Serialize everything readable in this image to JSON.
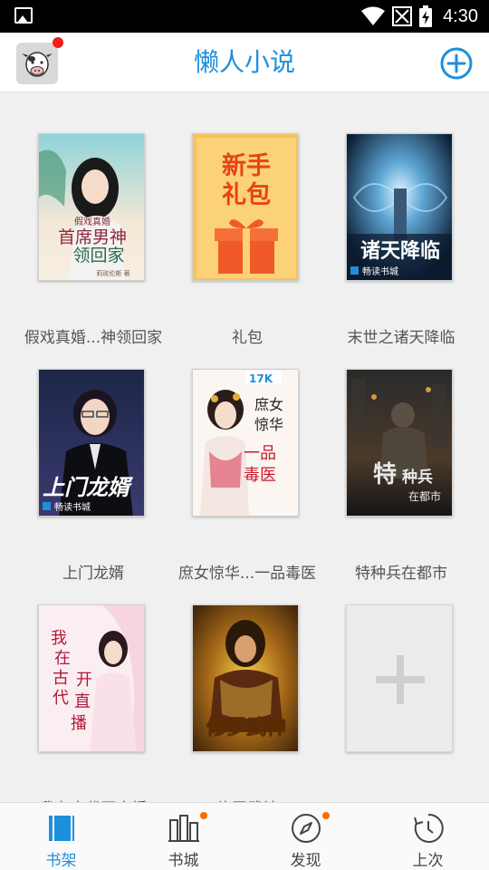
{
  "status_bar": {
    "time": "4:30"
  },
  "header": {
    "title": "懒人小说"
  },
  "books": [
    {
      "title": "假戏真婚...神领回家",
      "cover_text": "假戏真婚 首席男神 领回家"
    },
    {
      "title": "礼包",
      "cover_text": "新手 礼包"
    },
    {
      "title": "末世之诸天降临",
      "cover_text": "诸天降临",
      "cover_badge": "畅读书城"
    },
    {
      "title": "上门龙婿",
      "cover_text": "上门龙婿",
      "cover_badge": "畅读书城"
    },
    {
      "title": "庶女惊华...一品毒医",
      "cover_text": "庶女惊华 一品毒医",
      "cover_badge": "17K"
    },
    {
      "title": "特种兵在都市",
      "cover_text": "特种兵 在都市"
    },
    {
      "title": "我在古代开直播",
      "cover_text": "我在古代开直播"
    },
    {
      "title": "修罗武神",
      "cover_text": "修罗武神"
    }
  ],
  "bottom_nav": [
    {
      "label": "书架",
      "icon": "bookshelf-icon",
      "active": true
    },
    {
      "label": "书城",
      "icon": "bookstore-icon",
      "badge": true
    },
    {
      "label": "发现",
      "icon": "compass-icon",
      "badge": true
    },
    {
      "label": "上次",
      "icon": "history-icon"
    }
  ],
  "colors": {
    "accent": "#1e8fdc",
    "badge_red": "#f01e1e",
    "badge_orange": "#ff6a00"
  }
}
